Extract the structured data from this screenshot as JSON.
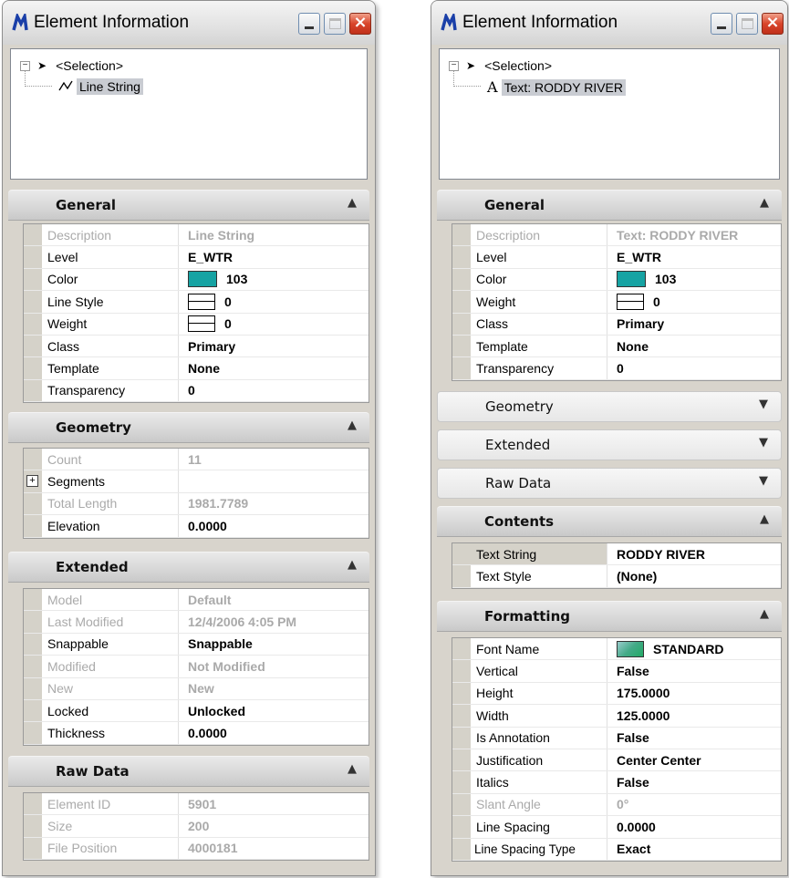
{
  "left": {
    "title": "Element Information",
    "tree": {
      "root": "<Selection>",
      "child": "Line String",
      "child_icon": "linestring-icon"
    },
    "sections": {
      "general": {
        "title": "General",
        "rows": [
          {
            "label": "Description",
            "value": "Line String",
            "disabled": true
          },
          {
            "label": "Level",
            "value": "E_WTR"
          },
          {
            "label": "Color",
            "value": "103"
          },
          {
            "label": "Line Style",
            "value": "0"
          },
          {
            "label": "Weight",
            "value": "0"
          },
          {
            "label": "Class",
            "value": "Primary"
          },
          {
            "label": "Template",
            "value": "None"
          },
          {
            "label": "Transparency",
            "value": "0"
          }
        ]
      },
      "geometry": {
        "title": "Geometry",
        "rows": [
          {
            "label": "Count",
            "value": "11",
            "disabled": true
          },
          {
            "label": "Segments",
            "value": ""
          },
          {
            "label": "Total Length",
            "value": "1981.7789",
            "disabled": true
          },
          {
            "label": "Elevation",
            "value": "0.0000"
          }
        ]
      },
      "extended": {
        "title": "Extended",
        "rows": [
          {
            "label": "Model",
            "value": "Default",
            "disabled": true
          },
          {
            "label": "Last Modified",
            "value": "12/4/2006 4:05 PM",
            "disabled": true
          },
          {
            "label": "Snappable",
            "value": "Snappable"
          },
          {
            "label": "Modified",
            "value": "Not Modified",
            "disabled": true
          },
          {
            "label": "New",
            "value": "New",
            "disabled": true
          },
          {
            "label": "Locked",
            "value": "Unlocked"
          },
          {
            "label": "Thickness",
            "value": "0.0000"
          }
        ]
      },
      "raw": {
        "title": "Raw Data",
        "rows": [
          {
            "label": "Element ID",
            "value": "5901",
            "disabled": true
          },
          {
            "label": "Size",
            "value": "200",
            "disabled": true
          },
          {
            "label": "File Position",
            "value": "4000181",
            "disabled": true
          }
        ]
      }
    }
  },
  "right": {
    "title": "Element Information",
    "tree": {
      "root": "<Selection>",
      "child": "Text: RODDY RIVER",
      "child_icon": "text-element-icon"
    },
    "sections": {
      "general": {
        "title": "General",
        "rows": [
          {
            "label": "Description",
            "value": "Text: RODDY RIVER",
            "disabled": true
          },
          {
            "label": "Level",
            "value": "E_WTR"
          },
          {
            "label": "Color",
            "value": "103"
          },
          {
            "label": "Weight",
            "value": "0"
          },
          {
            "label": "Class",
            "value": "Primary"
          },
          {
            "label": "Template",
            "value": "None"
          },
          {
            "label": "Transparency",
            "value": "0"
          }
        ]
      },
      "geometry": {
        "title": "Geometry"
      },
      "extended": {
        "title": "Extended"
      },
      "raw": {
        "title": "Raw Data"
      },
      "contents": {
        "title": "Contents",
        "rows": [
          {
            "label": "Text String",
            "value": "RODDY RIVER"
          },
          {
            "label": "Text Style",
            "value": "(None)"
          }
        ]
      },
      "formatting": {
        "title": "Formatting",
        "rows": [
          {
            "label": "Font Name",
            "value": "STANDARD"
          },
          {
            "label": "Vertical",
            "value": "False"
          },
          {
            "label": "Height",
            "value": "175.0000"
          },
          {
            "label": "Width",
            "value": "125.0000"
          },
          {
            "label": "Is Annotation",
            "value": "False"
          },
          {
            "label": "Justification",
            "value": "Center Center"
          },
          {
            "label": "Italics",
            "value": "False"
          },
          {
            "label": "Slant Angle",
            "value": "0°",
            "disabled": true
          },
          {
            "label": "Line Spacing",
            "value": "0.0000"
          },
          {
            "label": "Line Spacing Type",
            "value": "Exact"
          }
        ]
      }
    }
  },
  "colors": {
    "color_103": "#16a3a3",
    "section_header": "#c9c9c9",
    "close_button": "#d9452b"
  }
}
